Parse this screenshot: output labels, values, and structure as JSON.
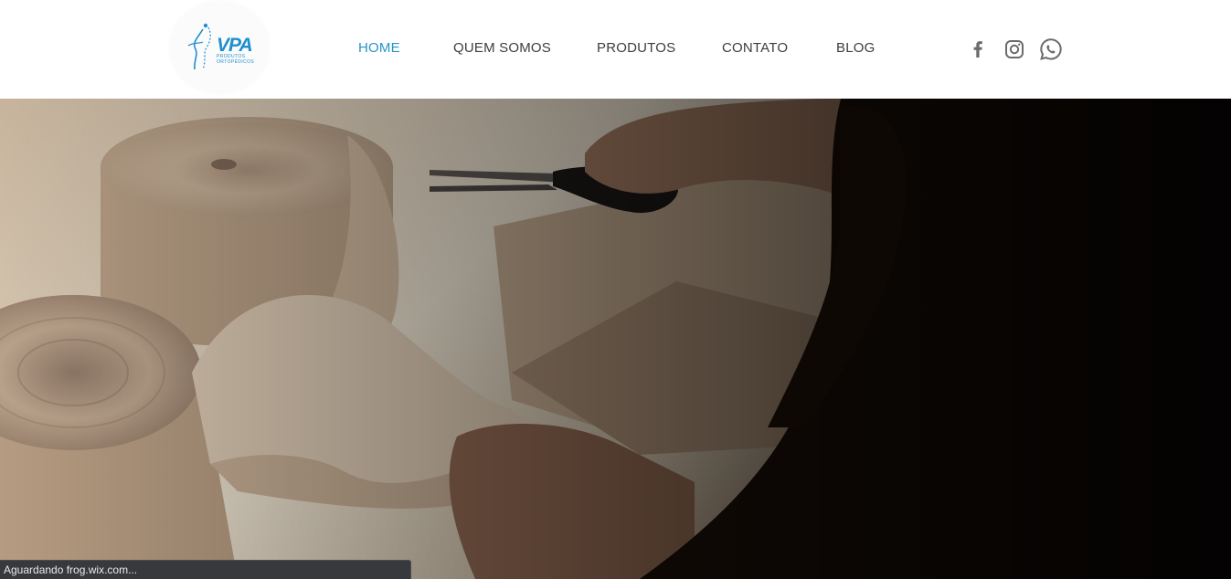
{
  "logo": {
    "mark": "VPA",
    "subtitle_line1": "PRODUTOS",
    "subtitle_line2": "ORTOPÉDICOS"
  },
  "nav": {
    "items": [
      {
        "label": "HOME",
        "active": true
      },
      {
        "label": "QUEM SOMOS",
        "active": false
      },
      {
        "label": "PRODUTOS",
        "active": false
      },
      {
        "label": "CONTATO",
        "active": false
      },
      {
        "label": "BLOG",
        "active": false
      }
    ]
  },
  "social": {
    "icons": [
      "facebook-icon",
      "instagram-icon",
      "whatsapp-icon"
    ],
    "color": "#6b6b6b"
  },
  "hero": {
    "image": "workshop-cutting-leather-rolls"
  },
  "status": {
    "text": "Aguardando frog.wix.com..."
  },
  "colors": {
    "accent": "#2895c9",
    "nav_text": "#3d3d3d",
    "logo_blue": "#1f8fd0"
  }
}
